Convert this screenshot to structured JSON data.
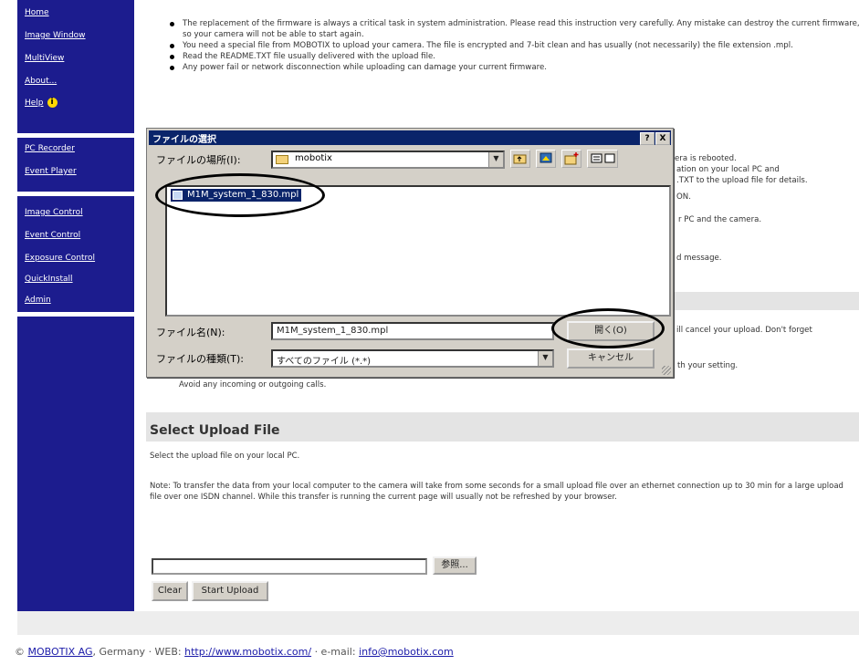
{
  "sidebar": {
    "items": [
      {
        "label": "Home"
      },
      {
        "label": "Image Window"
      },
      {
        "label": "MultiView"
      },
      {
        "label": "About..."
      },
      {
        "label": "Help"
      },
      {
        "label": "PC Recorder"
      },
      {
        "label": "Event Player"
      },
      {
        "label": "Image Control"
      },
      {
        "label": "Event Control"
      },
      {
        "label": "Exposure Control"
      },
      {
        "label": "QuickInstall"
      },
      {
        "label": "Admin"
      }
    ],
    "help_icon": "info-icon"
  },
  "main": {
    "bullets": [
      "The replacement of the firmware is always a critical task in system administration. Please read this instruction very carefully. Any mistake can destroy the current firmware, so your camera will not be able to start again.",
      "You need a special file from MOBOTIX to upload your camera. The file is encrypted and 7-bit clean and has usually (not necessarily) the file extension .mpl.",
      "Read the README.TXT file usually delivered with the upload file.",
      "Any power fail or network disconnection while uploading can damage your current firmware."
    ],
    "obscured_fragments": [
      "era is rebooted.",
      "ation on your local PC and",
      ".TXT to the upload file for details.",
      "ON.",
      "r PC and the camera.",
      "d message.",
      "ill cancel your upload. Don't forget",
      "th your setting.",
      "Avoid any incoming or outgoing calls."
    ],
    "section_title": "Select Upload File",
    "select_hint": "Select the upload file on your local PC.",
    "note": "Note: To transfer the data from your local computer to the camera will take from some seconds for a small upload file over an ethernet connection up to 30 min for a large upload file over one ISDN channel. While this transfer is running the current page will usually not be refreshed by your browser.",
    "file_input_value": "",
    "browse_label": "参照...",
    "clear_label": "Clear",
    "start_upload_label": "Start Upload"
  },
  "footer": {
    "copyright": "©",
    "company_link": "MOBOTIX AG",
    "country_text": ", Germany · WEB:",
    "web_link": "http://www.mobotix.com/",
    "email_text": "· e-mail:",
    "email_link": "info@mobotix.com"
  },
  "dialog": {
    "title": "ファイルの選択",
    "help_btn": "?",
    "close_btn": "X",
    "location_label": "ファイルの場所(I):",
    "location_value": "mobotix",
    "files": [
      "M1M_system_1_830.mpl"
    ],
    "filename_label": "ファイル名(N):",
    "filename_value": "M1M_system_1_830.mpl",
    "filetype_label": "ファイルの種類(T):",
    "filetype_value": "すべてのファイル (*.*)",
    "open_label": "開く(O)",
    "cancel_label": "キャンセル",
    "toolbar_icons": [
      "up-folder-icon",
      "desktop-icon",
      "new-folder-icon",
      "view-menu-icon"
    ]
  },
  "colors": {
    "sidebar_bg": "#1c1c8e",
    "dialog_title_bg": "#0a246a",
    "dialog_bg": "#d4d0c8",
    "link_color": "#1a1aa8",
    "section_bar": "#e4e4e4"
  }
}
